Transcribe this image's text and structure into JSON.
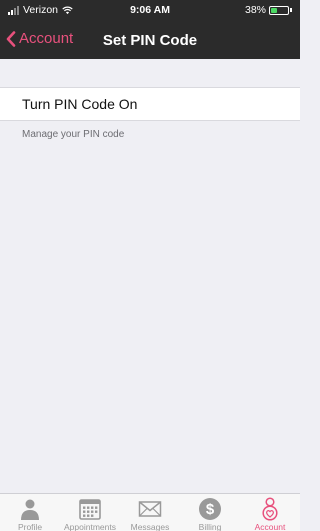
{
  "status_bar": {
    "carrier": "Verizon",
    "time": "9:06 AM",
    "battery_percent": "38%",
    "battery_level": 0.38
  },
  "nav": {
    "back_label": "Account",
    "title": "Set PIN Code"
  },
  "pin_toggle": {
    "label": "Turn PIN Code On"
  },
  "hint": "Manage your PIN code",
  "tabs": [
    {
      "label": "Profile",
      "icon": "person-icon"
    },
    {
      "label": "Appointments",
      "icon": "calendar-icon"
    },
    {
      "label": "Messages",
      "icon": "envelope-icon"
    },
    {
      "label": "Billing",
      "icon": "dollar-icon"
    },
    {
      "label": "Account",
      "icon": "account-icon"
    }
  ],
  "colors": {
    "accent": "#e8517d",
    "bar_background": "#2b2b2b",
    "inactive_tab": "#999999"
  }
}
